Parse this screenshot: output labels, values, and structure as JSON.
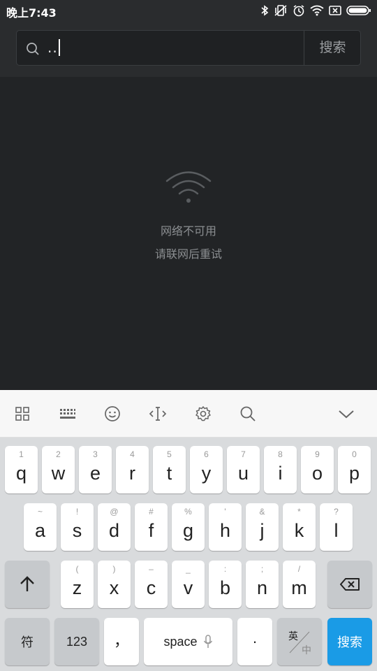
{
  "status_bar": {
    "time": "晚上7:43",
    "icons": [
      "bluetooth-icon",
      "vibrate-off-icon",
      "alarm-icon",
      "wifi-icon",
      "sim-x-icon",
      "battery-icon"
    ]
  },
  "search": {
    "query": "..",
    "button_label": "搜索",
    "icon": "search-icon"
  },
  "empty_state": {
    "icon": "wifi-icon",
    "title": "网络不可用",
    "subtitle": "请联网后重试"
  },
  "keyboard_toolbar": {
    "icons": [
      "grid-icon",
      "keyboard-icon",
      "emoji-icon",
      "cursor-move-icon",
      "settings-icon",
      "search-icon",
      "collapse-icon"
    ]
  },
  "keyboard": {
    "row1": [
      {
        "main": "q",
        "sub": "1"
      },
      {
        "main": "w",
        "sub": "2"
      },
      {
        "main": "e",
        "sub": "3"
      },
      {
        "main": "r",
        "sub": "4"
      },
      {
        "main": "t",
        "sub": "5"
      },
      {
        "main": "y",
        "sub": "6"
      },
      {
        "main": "u",
        "sub": "7"
      },
      {
        "main": "i",
        "sub": "8"
      },
      {
        "main": "o",
        "sub": "9"
      },
      {
        "main": "p",
        "sub": "0"
      }
    ],
    "row2": [
      {
        "main": "a",
        "sub": "~"
      },
      {
        "main": "s",
        "sub": "!"
      },
      {
        "main": "d",
        "sub": "@"
      },
      {
        "main": "f",
        "sub": "#"
      },
      {
        "main": "g",
        "sub": "%"
      },
      {
        "main": "h",
        "sub": "'"
      },
      {
        "main": "j",
        "sub": "&"
      },
      {
        "main": "k",
        "sub": "*"
      },
      {
        "main": "l",
        "sub": "?"
      }
    ],
    "row3": [
      {
        "main": "z",
        "sub": "("
      },
      {
        "main": "x",
        "sub": ")"
      },
      {
        "main": "c",
        "sub": "–"
      },
      {
        "main": "v",
        "sub": "_"
      },
      {
        "main": "b",
        "sub": ":"
      },
      {
        "main": "n",
        "sub": ";"
      },
      {
        "main": "m",
        "sub": "/"
      }
    ],
    "symbols_label": "符",
    "numbers_label": "123",
    "comma_label": "，",
    "space_label": "space",
    "period_label": "·",
    "lang_en": "英",
    "lang_zh": "中",
    "enter_label": "搜索",
    "accent_color": "#1a9be6"
  }
}
